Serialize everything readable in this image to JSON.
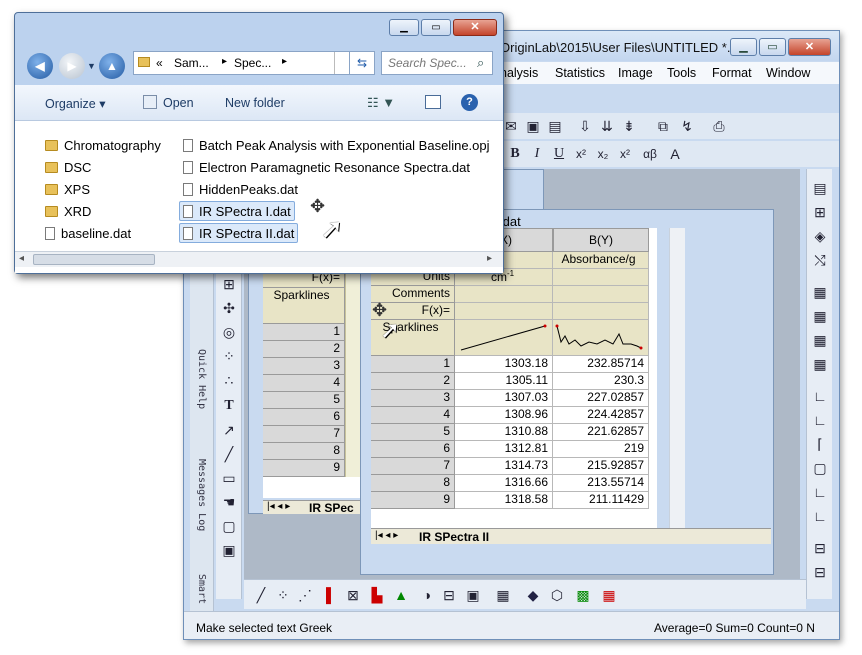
{
  "origin": {
    "title": "OriginLab\\2015\\User Files\\UNTITLED *...",
    "menu": [
      "nalysis",
      "Statistics",
      "Image",
      "Tools",
      "Format",
      "Window"
    ],
    "status_left": "Make selected text Greek",
    "status_right": "Average=0 Sum=0 Count=0 N",
    "dock_tabs": [
      "Quick Help",
      "Messages Log",
      "Smart"
    ]
  },
  "ws_back": {
    "label_rows": [
      "F(x)=",
      "Sparklines"
    ],
    "row_numbers": [
      "1",
      "2",
      "3",
      "4",
      "5",
      "6",
      "7",
      "8",
      "9"
    ],
    "sheet_tab": "IR SPec"
  },
  "ws_front": {
    "title": ".dat",
    "col_a": "(X)",
    "col_b": "B(Y)",
    "longname_a": "umbers",
    "longname_b": "Absorbance/g",
    "units_label": "Units",
    "units_a": "cm",
    "units_a_sup": "-1",
    "comments_label": "Comments",
    "fx_label": "F(x)=",
    "sparklines_label": "Sparklines",
    "rows": [
      {
        "n": "1",
        "x": "1303.18",
        "y": "232.85714"
      },
      {
        "n": "2",
        "x": "1305.11",
        "y": "230.3"
      },
      {
        "n": "3",
        "x": "1307.03",
        "y": "227.02857"
      },
      {
        "n": "4",
        "x": "1308.96",
        "y": "224.42857"
      },
      {
        "n": "5",
        "x": "1310.88",
        "y": "221.62857"
      },
      {
        "n": "6",
        "x": "1312.81",
        "y": "219"
      },
      {
        "n": "7",
        "x": "1314.73",
        "y": "215.92857"
      },
      {
        "n": "8",
        "x": "1316.66",
        "y": "213.55714"
      },
      {
        "n": "9",
        "x": "1318.58",
        "y": "211.11429"
      }
    ],
    "sheet_tab": "IR SPectra II"
  },
  "explorer": {
    "breadcrumb": [
      "«",
      "Sam...",
      "▸",
      "Spec...",
      "▸"
    ],
    "search_placeholder": "Search Spec...",
    "commands": {
      "organize": "Organize ▾",
      "open": "Open",
      "new_folder": "New folder"
    },
    "folders": [
      "Chromatography",
      "DSC",
      "XPS",
      "XRD"
    ],
    "files_left": [
      "baseline.dat"
    ],
    "files_right": [
      "Batch Peak Analysis with Exponential Baseline.opj",
      "Electron Paramagnetic Resonance Spectra.dat",
      "HiddenPeaks.dat",
      "IR SPectra I.dat",
      "IR SPectra II.dat"
    ]
  },
  "colors": {
    "accent": "#3a6ea5",
    "selection": "#dbe9fa",
    "label_rows": "#e8e4c6"
  }
}
